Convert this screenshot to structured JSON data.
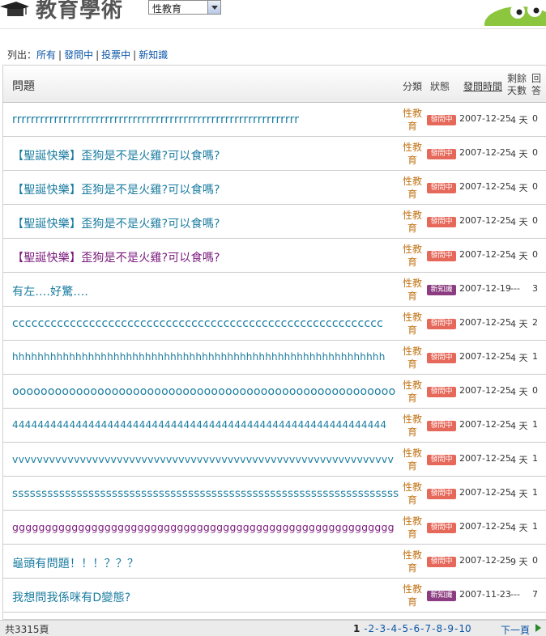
{
  "header": {
    "site_title": "教育學術",
    "category_selected": "性教育"
  },
  "filter": {
    "label": "列出：",
    "links": [
      "所有",
      "發問中",
      "投票中",
      "新知識"
    ]
  },
  "table": {
    "headers": {
      "question": "問題",
      "category": "分類",
      "status": "狀態",
      "time": "發問時間",
      "days_left": "剩餘天數",
      "answers": "回答"
    },
    "rows": [
      {
        "title": "rrrrrrrrrrrrrrrrrrrrrrrrrrrrrrrrrrrrrrrrrrrrrrrrrrrrrrrrrrrrrr",
        "category": "性教育",
        "status": "發問中",
        "date": "2007-12-25",
        "days": "4 天",
        "answers": "0",
        "badge": "ask",
        "visited": false
      },
      {
        "title": "【聖誕快樂】歪狗是不是火雞?可以食嗎?",
        "category": "性教育",
        "status": "發問中",
        "date": "2007-12-25",
        "days": "4 天",
        "answers": "0",
        "badge": "ask",
        "visited": false
      },
      {
        "title": "【聖誕快樂】歪狗是不是火雞?可以食嗎?",
        "category": "性教育",
        "status": "發問中",
        "date": "2007-12-25",
        "days": "4 天",
        "answers": "0",
        "badge": "ask",
        "visited": false
      },
      {
        "title": "【聖誕快樂】歪狗是不是火雞?可以食嗎?",
        "category": "性教育",
        "status": "發問中",
        "date": "2007-12-25",
        "days": "4 天",
        "answers": "0",
        "badge": "ask",
        "visited": false
      },
      {
        "title": "【聖誕快樂】歪狗是不是火雞?可以食嗎?",
        "category": "性教育",
        "status": "發問中",
        "date": "2007-12-25",
        "days": "4 天",
        "answers": "0",
        "badge": "ask",
        "visited": true
      },
      {
        "title": "有左....好驚....",
        "category": "性教育",
        "status": "新知識",
        "date": "2007-12-19",
        "days": "---",
        "answers": "3",
        "badge": "know",
        "visited": false
      },
      {
        "title": "cccccccccccccccccccccccccccccccccccccccccccccccccccccccccc",
        "category": "性教育",
        "status": "發問中",
        "date": "2007-12-25",
        "days": "4 天",
        "answers": "2",
        "badge": "ask",
        "visited": false
      },
      {
        "title": "hhhhhhhhhhhhhhhhhhhhhhhhhhhhhhhhhhhhhhhhhhhhhhhhhhhhhhhhhhh",
        "category": "性教育",
        "status": "發問中",
        "date": "2007-12-25",
        "days": "4 天",
        "answers": "1",
        "badge": "ask",
        "visited": false
      },
      {
        "title": "oooooooooooooooooooooooooooooooooooooooooooooooooooooo",
        "category": "性教育",
        "status": "發問中",
        "date": "2007-12-25",
        "days": "4 天",
        "answers": "0",
        "badge": "ask",
        "visited": false
      },
      {
        "title": "44444444444444444444444444444444444444444444444444444444444",
        "category": "性教育",
        "status": "發問中",
        "date": "2007-12-25",
        "days": "4 天",
        "answers": "1",
        "badge": "ask",
        "visited": false
      },
      {
        "title": "vvvvvvvvvvvvvvvvvvvvvvvvvvvvvvvvvvvvvvvvvvvvvvvvvvvvvvvvvvvvvv",
        "category": "性教育",
        "status": "發問中",
        "date": "2007-12-25",
        "days": "4 天",
        "answers": "1",
        "badge": "ask",
        "visited": false
      },
      {
        "title": "ssssssssssssssssssssssssssssssssssssssssssssssssssssssssssssssssss",
        "category": "性教育",
        "status": "發問中",
        "date": "2007-12-25",
        "days": "4 天",
        "answers": "1",
        "badge": "ask",
        "visited": false
      },
      {
        "title": "gggggggggggggggggggggggggggggggggggggggggggggggggggggggggg",
        "category": "性教育",
        "status": "發問中",
        "date": "2007-12-25",
        "days": "4 天",
        "answers": "1",
        "badge": "ask",
        "visited": true
      },
      {
        "title": "龜頭有問題！！！？？？",
        "category": "性教育",
        "status": "發問中",
        "date": "2007-12-25",
        "days": "9 天",
        "answers": "0",
        "badge": "ask",
        "visited": false
      },
      {
        "title": "我想問我係咪有D變態?",
        "category": "性教育",
        "status": "新知識",
        "date": "2007-11-23",
        "days": "---",
        "answers": "7",
        "badge": "know",
        "visited": false
      }
    ]
  },
  "footer": {
    "total": "共3315頁",
    "current_page": "1",
    "pages": [
      "2",
      "3",
      "4",
      "5",
      "6",
      "7",
      "8",
      "9",
      "10"
    ],
    "next": "下一頁"
  },
  "colors": {
    "title_link": "#1a7ca0",
    "visited_link": "#7a1a7c",
    "category": "#c1761a",
    "badge_ask": "#e6685a",
    "badge_know": "#8c3c80",
    "nav_link": "#0b55a8"
  }
}
